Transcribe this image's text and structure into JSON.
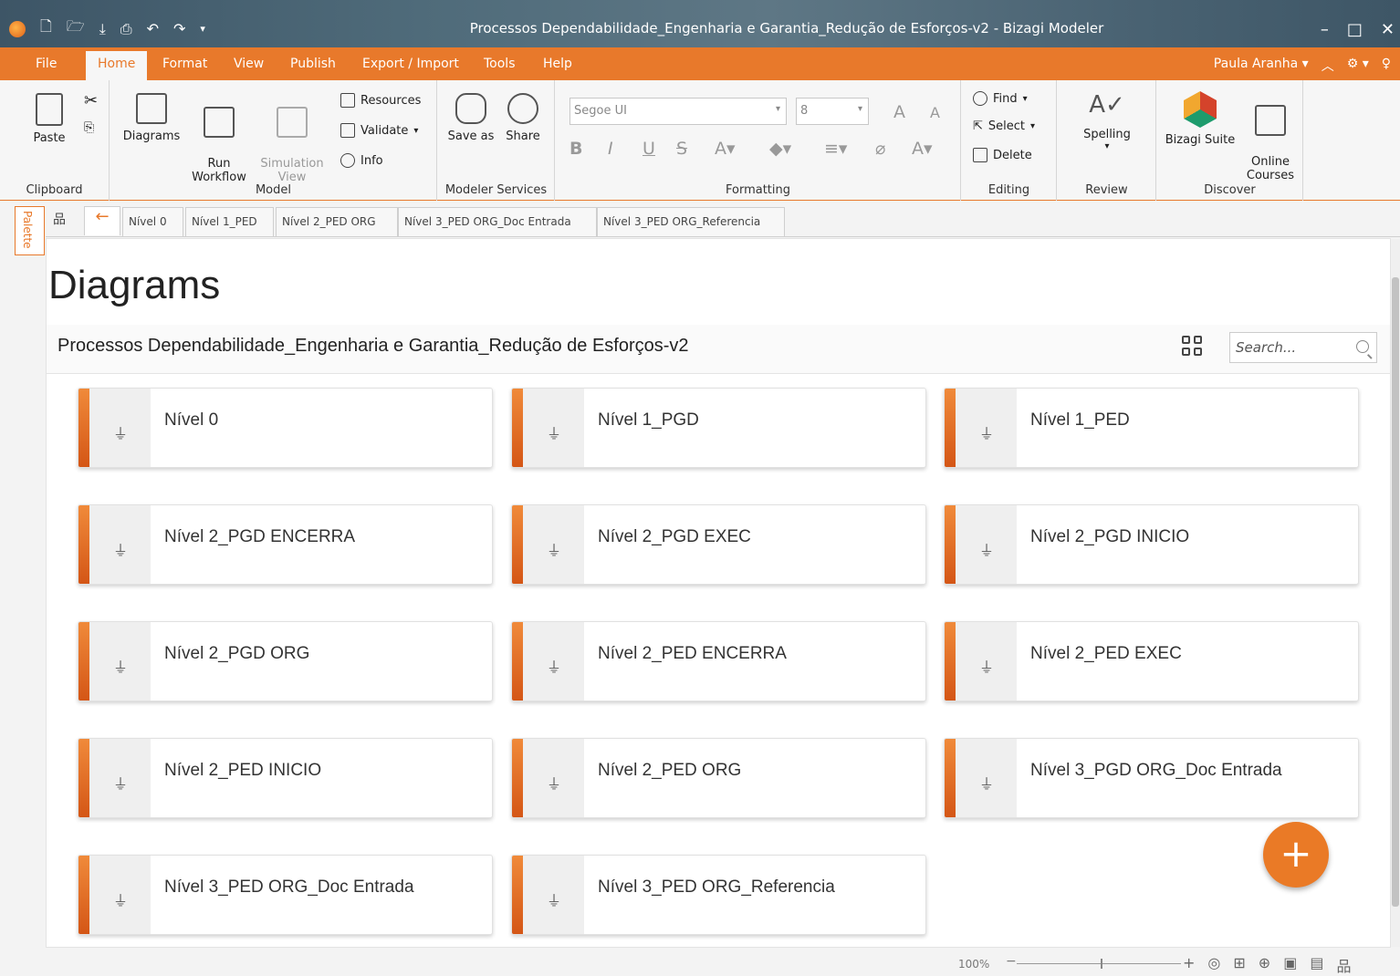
{
  "window": {
    "title": "Processos Dependabilidade_Engenharia e Garantia_Redução de Esforços-v2 - Bizagi Modeler",
    "controls": [
      "–",
      "□",
      "✕"
    ]
  },
  "menu": {
    "items": [
      "File",
      "Home",
      "Format",
      "View",
      "Publish",
      "Export / Import",
      "Tools",
      "Help"
    ],
    "active": "Home",
    "user": "Paula Aranha"
  },
  "ribbon": {
    "clipboard": {
      "label": "Clipboard",
      "paste": "Paste"
    },
    "model": {
      "label": "Model",
      "diagrams": "Diagrams",
      "run_workflow": "Run\nWorkflow",
      "simulation_view": "Simulation\nView",
      "resources": "Resources",
      "validate": "Validate",
      "info": "Info"
    },
    "modeler_services": {
      "label": "Modeler Services",
      "save_as": "Save as",
      "share": "Share"
    },
    "formatting": {
      "label": "Formatting",
      "font": "Segoe UI",
      "size": "8"
    },
    "editing": {
      "label": "Editing",
      "find": "Find",
      "select": "Select",
      "delete": "Delete"
    },
    "review": {
      "label": "Review",
      "spelling": "Spelling"
    },
    "discover": {
      "label": "Discover",
      "bizagi_suite": "Bizagi Suite",
      "online_courses": "Online\nCourses"
    }
  },
  "palette_label": "Palette",
  "tabs": [
    "Nível 0",
    "Nível 1_PED",
    "Nível 2_PED ORG",
    "Nível 3_PED ORG_Doc Entrada",
    "Nível 3_PED ORG_Referencia"
  ],
  "page": {
    "title": "Diagrams",
    "project": "Processos Dependabilidade_Engenharia e Garantia_Redução de Esforços-v2",
    "search_placeholder": "Search..."
  },
  "diagrams": [
    "Nível 0",
    "Nível 1_PGD",
    "Nível 1_PED",
    "Nível 2_PGD ENCERRA",
    "Nível 2_PGD EXEC",
    "Nível 2_PGD INICIO",
    "Nível 2_PGD ORG",
    "Nível 2_PED ENCERRA",
    "Nível 2_PED EXEC",
    "Nível 2_PED INICIO",
    "Nível 2_PED ORG",
    "Nível 3_PGD ORG_Doc Entrada",
    "Nível 3_PED ORG_Doc Entrada",
    "Nível 3_PED ORG_Referencia"
  ],
  "fab_label": "+",
  "status": {
    "zoom": "100%",
    "zoom_level": 1.0
  },
  "colors": {
    "accent": "#e8792b",
    "titlebar": "#4f6b7a"
  }
}
